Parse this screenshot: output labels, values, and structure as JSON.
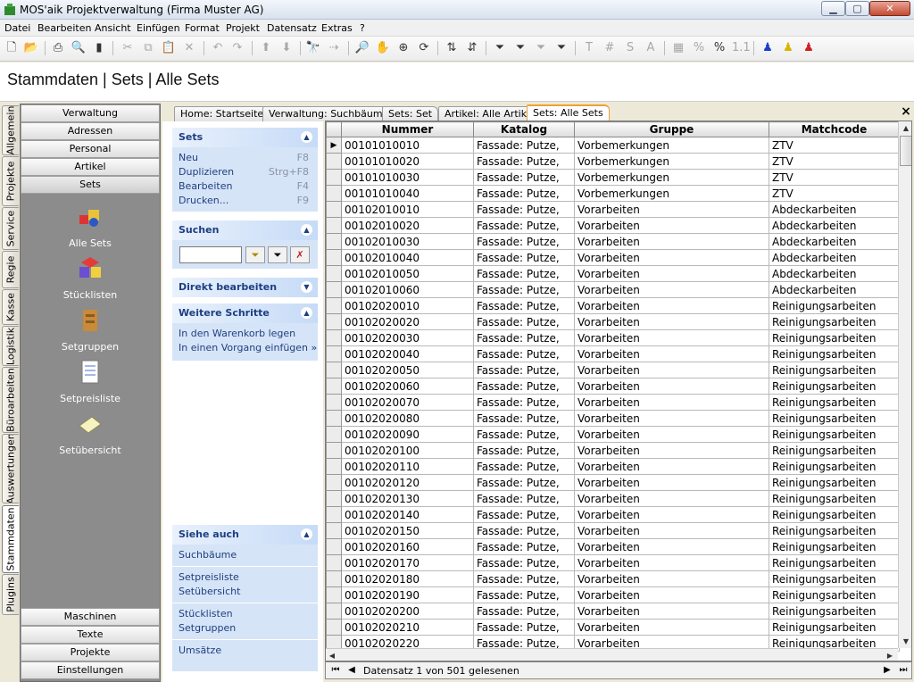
{
  "window": {
    "title": "MOS'aik Projektverwaltung (Firma Muster AG)"
  },
  "menu": [
    "Datei",
    "Bearbeiten",
    "Ansicht",
    "Einfügen",
    "Format",
    "Projekt",
    "Datensatz",
    "Extras",
    "?"
  ],
  "toolbar_icons": [
    "new-doc-icon",
    "open-folder-icon",
    "print-icon",
    "print-preview-icon",
    "export-icon",
    "cut-icon",
    "copy-icon",
    "paste-icon",
    "delete-icon",
    "undo-icon",
    "redo-icon",
    "arrow-up-icon",
    "arrow-down-icon",
    "find-icon",
    "find-next-icon",
    "zoom-icon",
    "hand-icon",
    "zoom-area-icon",
    "refresh-icon",
    "sort-asc-icon",
    "sort-desc-icon",
    "filter-icon",
    "filter-edit-icon",
    "filter-clear-icon",
    "filter-apply-icon",
    "text-icon",
    "hash-icon",
    "s-icon",
    "a-icon",
    "calc-icon",
    "percent-icon",
    "percent2-icon",
    "numbers-icon",
    "user-blue-icon",
    "user-yellow-icon",
    "user-red-icon"
  ],
  "header": {
    "title": "Stammdaten | Sets | Alle Sets"
  },
  "vertical_tabs": [
    "Allgemein",
    "Projekte",
    "Service",
    "Regie",
    "Kasse",
    "Logistik",
    "Büroarbeiten",
    "Auswertungen",
    "Stammdaten",
    "Plugins"
  ],
  "nav": {
    "top_buttons": [
      "Verwaltung",
      "Adressen",
      "Personal",
      "Artikel",
      "Sets"
    ],
    "icons": [
      "Alle Sets",
      "Stücklisten",
      "Setgruppen",
      "Setpreisliste",
      "Setübersicht"
    ],
    "bottom_buttons": [
      "Maschinen",
      "Texte",
      "Projekte",
      "Einstellungen"
    ]
  },
  "doc_tabs": [
    "Home: Startseite",
    "Verwaltung: Suchbäume",
    "Sets: Set",
    "Artikel: Alle Artikel",
    "Sets: Alle Sets"
  ],
  "task_pane": {
    "sets": {
      "title": "Sets",
      "items": [
        {
          "label": "Neu",
          "shortcut": "F8"
        },
        {
          "label": "Duplizieren",
          "shortcut": "Strg+F8"
        },
        {
          "label": "Bearbeiten",
          "shortcut": "F4"
        },
        {
          "label": "Drucken...",
          "shortcut": "F9"
        }
      ]
    },
    "suchen": {
      "title": "Suchen",
      "value": ""
    },
    "direkt": {
      "title": "Direkt bearbeiten"
    },
    "weitere": {
      "title": "Weitere Schritte",
      "items": [
        "In den Warenkorb legen",
        "In einen Vorgang einfügen »"
      ]
    },
    "siehe": {
      "title": "Siehe auch",
      "groups": [
        [
          "Suchbäume"
        ],
        [
          "Setpreisliste",
          "Setübersicht"
        ],
        [
          "Stücklisten",
          "Setgruppen"
        ],
        [
          "Umsätze"
        ]
      ]
    }
  },
  "grid": {
    "columns": [
      "Nummer",
      "Katalog",
      "Gruppe",
      "Matchcode"
    ],
    "rows": [
      [
        "00101010010",
        "Fassade: Putze,",
        "Vorbemerkungen",
        "ZTV"
      ],
      [
        "00101010020",
        "Fassade: Putze,",
        "Vorbemerkungen",
        "ZTV"
      ],
      [
        "00101010030",
        "Fassade: Putze,",
        "Vorbemerkungen",
        "ZTV"
      ],
      [
        "00101010040",
        "Fassade: Putze,",
        "Vorbemerkungen",
        "ZTV"
      ],
      [
        "00102010010",
        "Fassade: Putze,",
        "Vorarbeiten",
        "Abdeckarbeiten"
      ],
      [
        "00102010020",
        "Fassade: Putze,",
        "Vorarbeiten",
        "Abdeckarbeiten"
      ],
      [
        "00102010030",
        "Fassade: Putze,",
        "Vorarbeiten",
        "Abdeckarbeiten"
      ],
      [
        "00102010040",
        "Fassade: Putze,",
        "Vorarbeiten",
        "Abdeckarbeiten"
      ],
      [
        "00102010050",
        "Fassade: Putze,",
        "Vorarbeiten",
        "Abdeckarbeiten"
      ],
      [
        "00102010060",
        "Fassade: Putze,",
        "Vorarbeiten",
        "Abdeckarbeiten"
      ],
      [
        "00102020010",
        "Fassade: Putze,",
        "Vorarbeiten",
        "Reinigungsarbeiten"
      ],
      [
        "00102020020",
        "Fassade: Putze,",
        "Vorarbeiten",
        "Reinigungsarbeiten"
      ],
      [
        "00102020030",
        "Fassade: Putze,",
        "Vorarbeiten",
        "Reinigungsarbeiten"
      ],
      [
        "00102020040",
        "Fassade: Putze,",
        "Vorarbeiten",
        "Reinigungsarbeiten"
      ],
      [
        "00102020050",
        "Fassade: Putze,",
        "Vorarbeiten",
        "Reinigungsarbeiten"
      ],
      [
        "00102020060",
        "Fassade: Putze,",
        "Vorarbeiten",
        "Reinigungsarbeiten"
      ],
      [
        "00102020070",
        "Fassade: Putze,",
        "Vorarbeiten",
        "Reinigungsarbeiten"
      ],
      [
        "00102020080",
        "Fassade: Putze,",
        "Vorarbeiten",
        "Reinigungsarbeiten"
      ],
      [
        "00102020090",
        "Fassade: Putze,",
        "Vorarbeiten",
        "Reinigungsarbeiten"
      ],
      [
        "00102020100",
        "Fassade: Putze,",
        "Vorarbeiten",
        "Reinigungsarbeiten"
      ],
      [
        "00102020110",
        "Fassade: Putze,",
        "Vorarbeiten",
        "Reinigungsarbeiten"
      ],
      [
        "00102020120",
        "Fassade: Putze,",
        "Vorarbeiten",
        "Reinigungsarbeiten"
      ],
      [
        "00102020130",
        "Fassade: Putze,",
        "Vorarbeiten",
        "Reinigungsarbeiten"
      ],
      [
        "00102020140",
        "Fassade: Putze,",
        "Vorarbeiten",
        "Reinigungsarbeiten"
      ],
      [
        "00102020150",
        "Fassade: Putze,",
        "Vorarbeiten",
        "Reinigungsarbeiten"
      ],
      [
        "00102020160",
        "Fassade: Putze,",
        "Vorarbeiten",
        "Reinigungsarbeiten"
      ],
      [
        "00102020170",
        "Fassade: Putze,",
        "Vorarbeiten",
        "Reinigungsarbeiten"
      ],
      [
        "00102020180",
        "Fassade: Putze,",
        "Vorarbeiten",
        "Reinigungsarbeiten"
      ],
      [
        "00102020190",
        "Fassade: Putze,",
        "Vorarbeiten",
        "Reinigungsarbeiten"
      ],
      [
        "00102020200",
        "Fassade: Putze,",
        "Vorarbeiten",
        "Reinigungsarbeiten"
      ],
      [
        "00102020210",
        "Fassade: Putze,",
        "Vorarbeiten",
        "Reinigungsarbeiten"
      ],
      [
        "00102020220",
        "Fassade: Putze,",
        "Vorarbeiten",
        "Reinigungsarbeiten"
      ]
    ]
  },
  "status": {
    "text": "Datensatz 1 von 501 gelesenen"
  },
  "colors": {
    "pane_bg": "#d6e4f7",
    "pane_title": "#1c3f82",
    "nav_gray": "#8c8c8c"
  }
}
